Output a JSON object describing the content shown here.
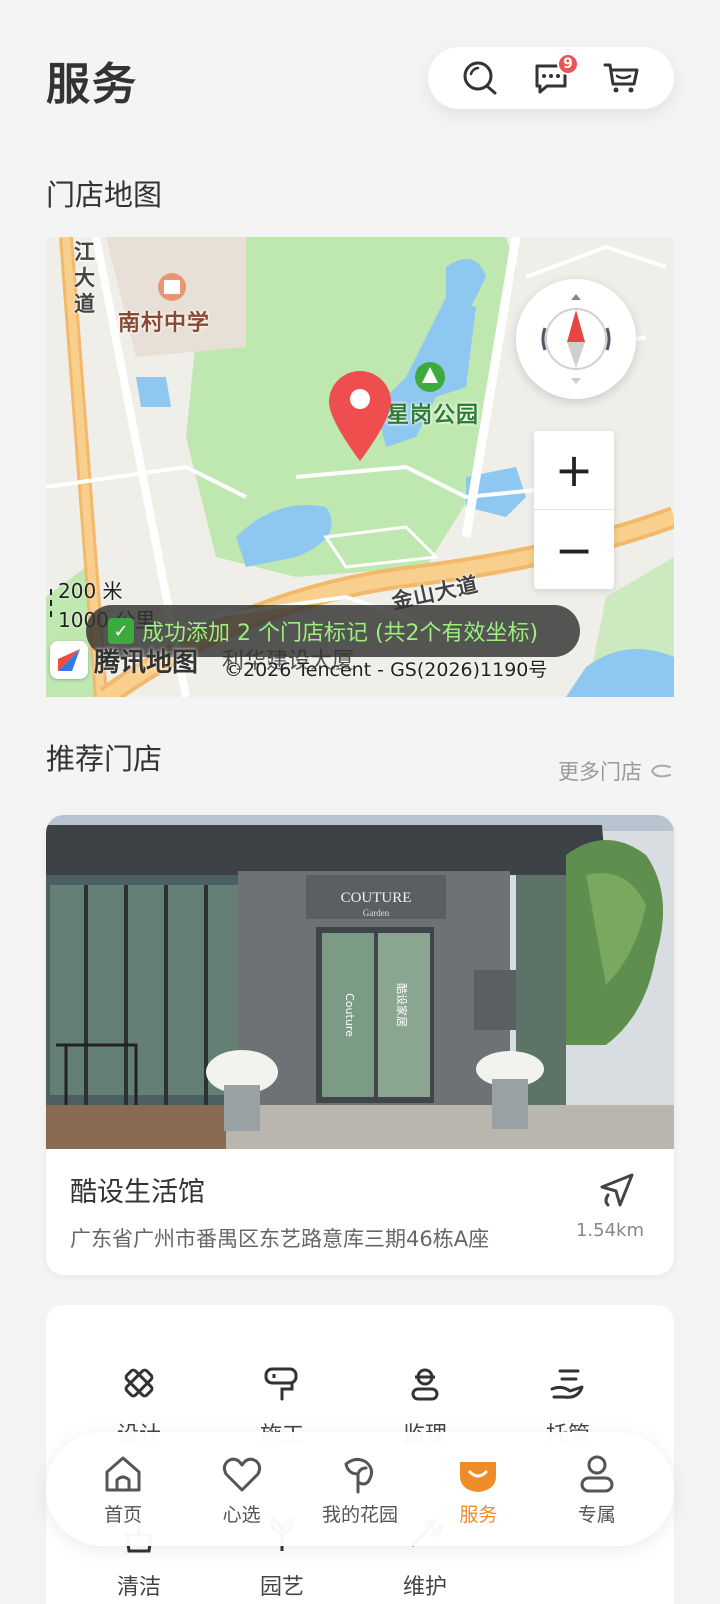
{
  "header": {
    "title": "服务",
    "message_badge": "9"
  },
  "map_section": {
    "title": "门店地图",
    "labels": {
      "school": "南村中学",
      "park": "七星岗公园",
      "road_left": "江大道",
      "road_bottom": "金山大道",
      "building": "利华建设大厦"
    },
    "scale_200": "200 米",
    "scale_1000": "1000 公里",
    "toast": "成功添加 2 个门店标记 (共2个有效坐标)",
    "logo_text": "腾讯地图",
    "copyright": "©2026 Tencent - GS(2026)1190号",
    "zoom_in": "+",
    "zoom_out": "−"
  },
  "stores_section": {
    "title": "推荐门店",
    "more": "更多门店",
    "store": {
      "name": "酷设生活馆",
      "address": "广东省广州市番禺区东艺路意库三期46栋A座",
      "distance": "1.54km",
      "sign_text": "COUTURE",
      "sign_sub": "Garden",
      "door_text_left": "Couture",
      "door_text_right": "酷设家居"
    }
  },
  "services": {
    "items": [
      {
        "label": "设计",
        "icon": "design-icon"
      },
      {
        "label": "施工",
        "icon": "construction-icon"
      },
      {
        "label": "监理",
        "icon": "supervision-icon"
      },
      {
        "label": "托管",
        "icon": "hosting-icon"
      },
      {
        "label": "清洁",
        "icon": "cleaning-icon"
      },
      {
        "label": "园艺",
        "icon": "gardening-icon"
      },
      {
        "label": "维护",
        "icon": "maintenance-icon"
      }
    ]
  },
  "tabbar": {
    "active_color": "#f08c28",
    "items": [
      {
        "label": "首页",
        "icon": "home-icon"
      },
      {
        "label": "心选",
        "icon": "heart-icon"
      },
      {
        "label": "我的花园",
        "icon": "leaf-icon"
      },
      {
        "label": "服务",
        "icon": "service-icon",
        "active": true
      },
      {
        "label": "专属",
        "icon": "user-icon"
      }
    ]
  }
}
